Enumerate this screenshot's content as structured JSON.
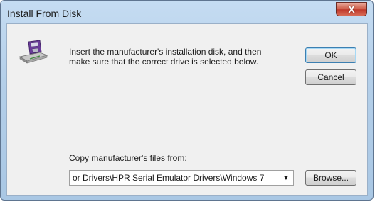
{
  "window": {
    "title": "Install From Disk",
    "close_label": "X"
  },
  "message": "Insert the manufacturer's installation disk, and then\nmake sure that the correct drive is selected below.",
  "buttons": {
    "ok": "OK",
    "cancel": "Cancel",
    "browse": "Browse..."
  },
  "copy_from": {
    "label": "Copy manufacturer's files from:",
    "value": "or Drivers\\HPR Serial Emulator Drivers\\Windows 7"
  },
  "icons": {
    "disk": "floppy-disk-drive-icon",
    "dropdown": "chevron-down-icon"
  }
}
